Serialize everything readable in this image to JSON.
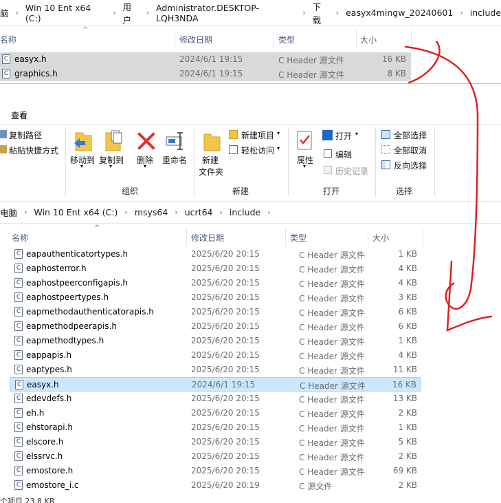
{
  "top_window": {
    "breadcrumb": [
      "脑",
      "Win 10 Ent x64 (C:)",
      "用户",
      "Administrator.DESKTOP-LQH3NDA",
      "下载",
      "easyx4mingw_20240601",
      "include"
    ],
    "columns": {
      "name": "名称",
      "modified": "修改日期",
      "type": "类型",
      "size": "大小"
    },
    "files": [
      {
        "icon": "c-header-icon",
        "name": "easyx.h",
        "modified": "2024/6/1 19:15",
        "type": "C Header 源文件",
        "size": "16 KB"
      },
      {
        "icon": "c-header-icon",
        "name": "graphics.h",
        "modified": "2024/6/1 19:15",
        "type": "C Header 源文件",
        "size": "8 KB"
      }
    ]
  },
  "ribbon": {
    "tab": "查看",
    "copy_path": "复制路径",
    "paste_shortcut": "粘贴快捷方式",
    "move_to": "移动到",
    "copy_to": "复制到",
    "delete": "删除",
    "rename": "重命名",
    "new_folder_line1": "新建",
    "new_folder_line2": "文件夹",
    "new_item": "新建项目",
    "easy_access": "轻松访问",
    "properties": "属性",
    "open": "打开",
    "edit": "编辑",
    "history": "历史记录",
    "select_all": "全部选择",
    "select_none": "全部取消",
    "invert_selection": "反向选择",
    "group_organize": "组织",
    "group_new": "新建",
    "group_open": "打开",
    "group_select": "选择"
  },
  "bottom_window": {
    "breadcrumb": [
      "电脑",
      "Win 10 Ent x64 (C:)",
      "msys64",
      "ucrt64",
      "include"
    ],
    "columns": {
      "name": "名称",
      "modified": "修改日期",
      "type": "类型",
      "size": "大小"
    },
    "files": [
      {
        "name": "eapauthenticatortypes.h",
        "modified": "2025/6/20 20:15",
        "type": "C Header 源文件",
        "size": "1 KB"
      },
      {
        "name": "eaphosterror.h",
        "modified": "2025/6/20 20:15",
        "type": "C Header 源文件",
        "size": "4 KB"
      },
      {
        "name": "eaphostpeerconfigapis.h",
        "modified": "2025/6/20 20:15",
        "type": "C Header 源文件",
        "size": "4 KB"
      },
      {
        "name": "eaphostpeertypes.h",
        "modified": "2025/6/20 20:15",
        "type": "C Header 源文件",
        "size": "3 KB"
      },
      {
        "name": "eapmethodauthenticatorapis.h",
        "modified": "2025/6/20 20:15",
        "type": "C Header 源文件",
        "size": "6 KB"
      },
      {
        "name": "eapmethodpeerapis.h",
        "modified": "2025/6/20 20:15",
        "type": "C Header 源文件",
        "size": "6 KB"
      },
      {
        "name": "eapmethodtypes.h",
        "modified": "2025/6/20 20:15",
        "type": "C Header 源文件",
        "size": "1 KB"
      },
      {
        "name": "eappapis.h",
        "modified": "2025/6/20 20:15",
        "type": "C Header 源文件",
        "size": "4 KB"
      },
      {
        "name": "eaptypes.h",
        "modified": "2025/6/20 20:15",
        "type": "C Header 源文件",
        "size": "11 KB"
      },
      {
        "name": "easyx.h",
        "modified": "2024/6/1 19:15",
        "type": "C Header 源文件",
        "size": "16 KB",
        "selected": true
      },
      {
        "name": "edevdefs.h",
        "modified": "2025/6/20 20:15",
        "type": "C Header 源文件",
        "size": "13 KB"
      },
      {
        "name": "eh.h",
        "modified": "2025/6/20 20:15",
        "type": "C Header 源文件",
        "size": "2 KB"
      },
      {
        "name": "ehstorapi.h",
        "modified": "2025/6/20 20:15",
        "type": "C Header 源文件",
        "size": "1 KB"
      },
      {
        "name": "elscore.h",
        "modified": "2025/6/20 20:15",
        "type": "C Header 源文件",
        "size": "5 KB"
      },
      {
        "name": "elssrvc.h",
        "modified": "2025/6/20 20:15",
        "type": "C Header 源文件",
        "size": "2 KB"
      },
      {
        "name": "emostore.h",
        "modified": "2025/6/20 20:15",
        "type": "C Header 源文件",
        "size": "69 KB"
      },
      {
        "name": "emostore_i.c",
        "modified": "2025/6/20 20:19",
        "type": "C 源文件",
        "size": "2 KB"
      }
    ],
    "status": "个项目  23.8 KB"
  },
  "annotation": {
    "color": "#e02020",
    "icon": "red-arrow-annotation"
  }
}
